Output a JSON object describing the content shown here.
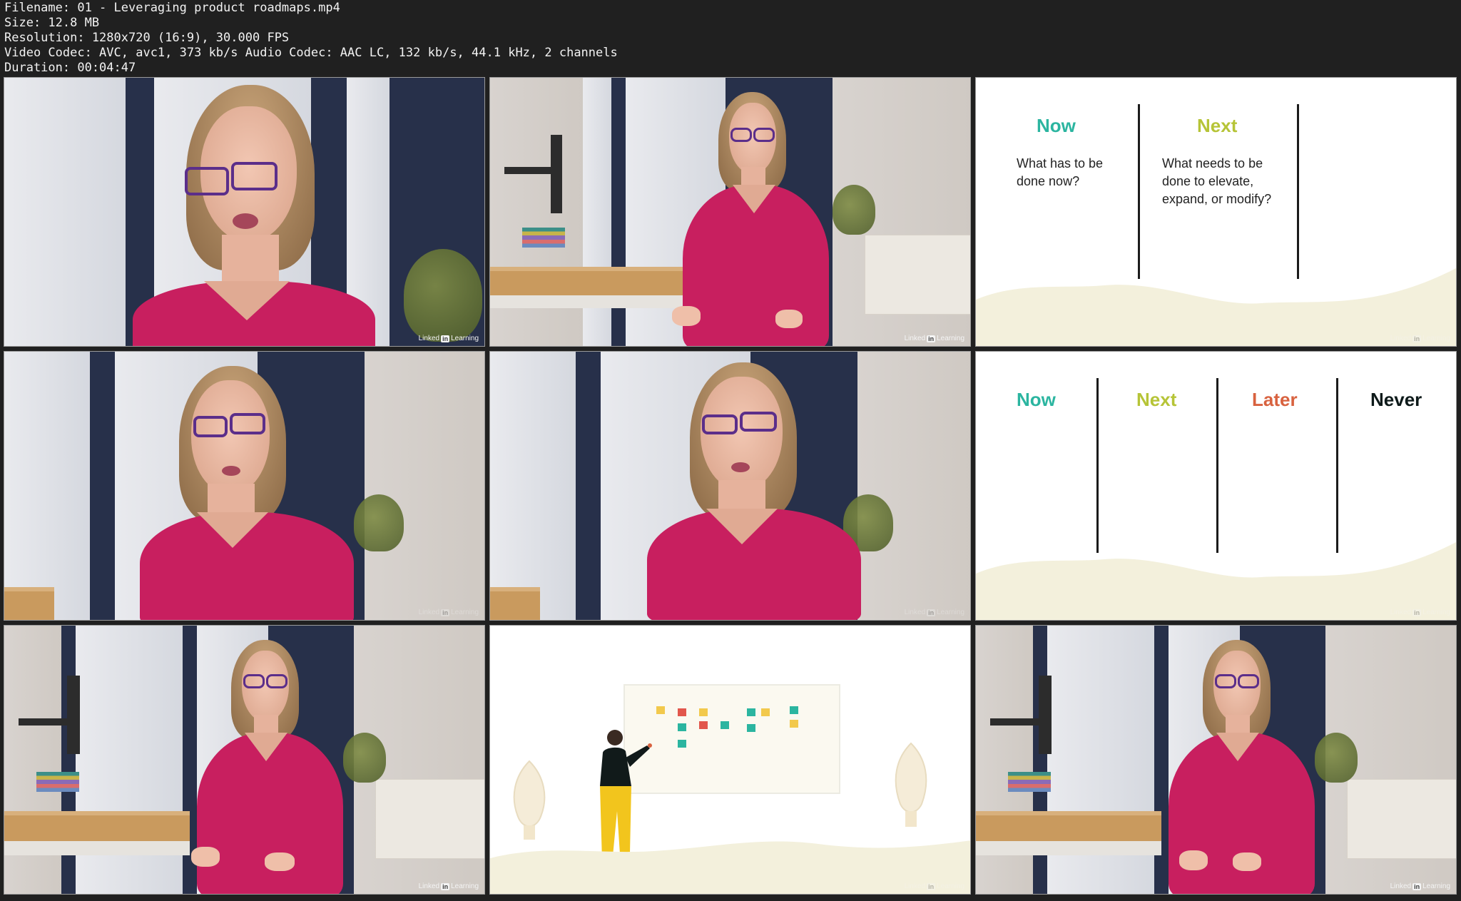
{
  "meta": {
    "filename": "Filename: 01 - Leveraging product roadmaps.mp4",
    "size": "Size: 12.8 MB",
    "resolution": "Resolution: 1280x720 (16:9), 30.000 FPS",
    "codec": "Video Codec: AVC, avc1, 373 kb/s Audio Codec: AAC LC, 132 kb/s, 44.1 kHz, 2 channels",
    "duration": "Duration: 00:04:47"
  },
  "watermark": {
    "pre": "Linked",
    "in": "in",
    "post": "Learning"
  },
  "slide_two_col": {
    "col1": {
      "heading": "Now",
      "text": "What has to be done now?",
      "color": "#2bb5a0"
    },
    "col2": {
      "heading": "Next",
      "text": "What needs to be done to elevate, expand, or modify?",
      "color": "#b6c437"
    }
  },
  "slide_four_col": {
    "cols": [
      {
        "heading": "Now",
        "color": "#2bb5a0"
      },
      {
        "heading": "Next",
        "color": "#b6c437"
      },
      {
        "heading": "Later",
        "color": "#d8623f"
      },
      {
        "heading": "Never",
        "color": "#0e1a1a"
      }
    ]
  },
  "colors": {
    "wave": "#f3f0dc",
    "shirt": "#c81f5f",
    "glasses": "#5b2e8a"
  }
}
